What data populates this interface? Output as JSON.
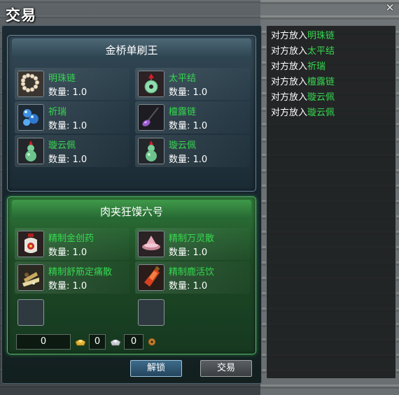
{
  "window": {
    "title": "交易",
    "close_glyph": "✕"
  },
  "partner": {
    "name": "金桥单刷王",
    "items": [
      {
        "name": "明珠链",
        "qty_label": "数量: 1.0",
        "icon": "pearl-necklace-icon"
      },
      {
        "name": "太平结",
        "qty_label": "数量: 1.0",
        "icon": "jade-pendant-icon"
      },
      {
        "name": "祈瑞",
        "qty_label": "数量: 1.0",
        "icon": "blue-gems-icon"
      },
      {
        "name": "檀露链",
        "qty_label": "数量: 1.0",
        "icon": "amethyst-necklace-icon"
      },
      {
        "name": "璇云佩",
        "qty_label": "数量: 1.0",
        "icon": "jade-gourd-icon"
      },
      {
        "name": "璇云佩",
        "qty_label": "数量: 1.0",
        "icon": "jade-gourd-icon"
      }
    ]
  },
  "self": {
    "name": "肉夹狂馍六号",
    "items": [
      {
        "name": "精制金创药",
        "qty_label": "数量: 1.0",
        "icon": "medicine-gourd-icon"
      },
      {
        "name": "精制万灵散",
        "qty_label": "数量: 1.0",
        "icon": "powder-bowl-icon"
      },
      {
        "name": "精制舒筋定痛散",
        "qty_label": "数量: 1.0",
        "icon": "herb-bundle-icon"
      },
      {
        "name": "精制鹿活饮",
        "qty_label": "数量: 1.0",
        "icon": "red-flask-icon"
      }
    ],
    "empty_slots": 2,
    "money": {
      "primary": "0",
      "gold_ingot": "0",
      "silver_ingot": "0"
    }
  },
  "buttons": {
    "unlock": "解锁",
    "trade": "交易"
  },
  "log": {
    "prefix": "对方放入",
    "entries": [
      "明珠链",
      "太平结",
      "祈瑞",
      "檀露链",
      "璇云佩",
      "璇云佩"
    ]
  },
  "colors": {
    "item_name": "#36d84f",
    "self_panel_accent": "#58b86a",
    "partner_panel_accent": "#6c8796"
  }
}
